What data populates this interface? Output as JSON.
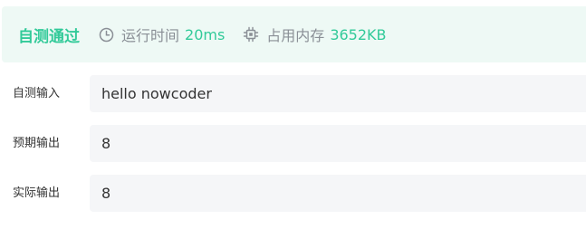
{
  "status": {
    "title": "自测通过",
    "runtime": {
      "icon": "clock-icon",
      "label": "运行时间",
      "value": "20ms"
    },
    "memory": {
      "icon": "chip-icon",
      "label": "占用内存",
      "value": "3652KB"
    }
  },
  "rows": [
    {
      "label": "自测输入",
      "value": "hello nowcoder"
    },
    {
      "label": "预期输出",
      "value": "8"
    },
    {
      "label": "实际输出",
      "value": "8"
    }
  ],
  "colors": {
    "accent": "#32ca99",
    "status_background": "#eef9f5",
    "field_background": "#f5f6f8",
    "muted_text": "#8a8f96"
  }
}
